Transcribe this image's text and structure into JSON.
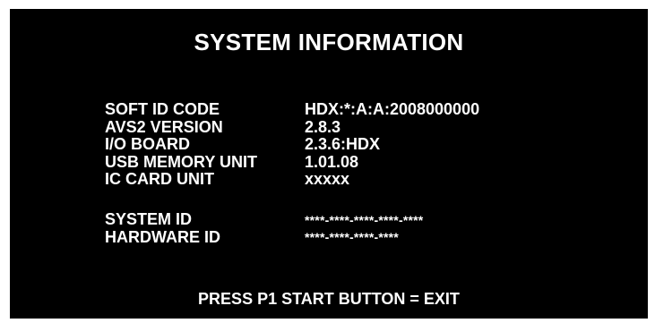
{
  "title": "SYSTEM INFORMATION",
  "info": [
    {
      "label": "SOFT ID CODE",
      "value": "HDX:*:A:A:2008000000"
    },
    {
      "label": "AVS2 VERSION",
      "value": "2.8.3"
    },
    {
      "label": "I/O BOARD",
      "value": "2.3.6:HDX"
    },
    {
      "label": "USB MEMORY UNIT",
      "value": "1.01.08"
    },
    {
      "label": "IC CARD UNIT",
      "value": "xxxxx"
    }
  ],
  "ids": [
    {
      "label": "SYSTEM ID",
      "value": "****-****-****-****-****"
    },
    {
      "label": "HARDWARE ID",
      "value": "****-****-****-****"
    }
  ],
  "footer": "PRESS P1 START BUTTON = EXIT",
  "colors": {
    "background": "#000000",
    "text": "#ffffff",
    "border": "#ffffff"
  }
}
